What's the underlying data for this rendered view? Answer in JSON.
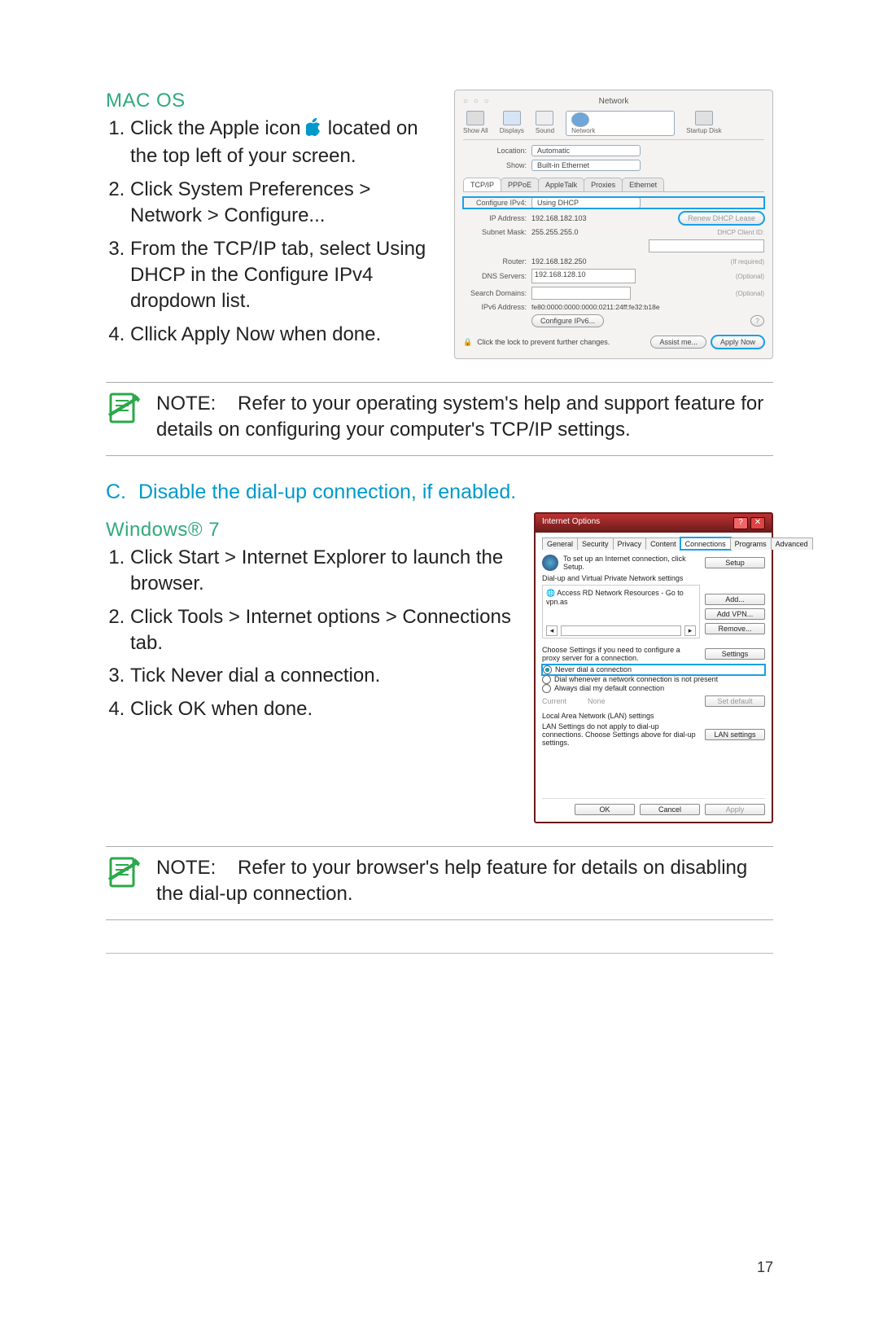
{
  "page_number": "17",
  "section_mac": {
    "title": "MAC OS",
    "steps": [
      "Click the Apple icon      located on the top left of your screen.",
      "Click System Preferences > Network > Configure...",
      "From the TCP/IP tab, select Using DHCP in the Configure IPv4 dropdown list.",
      "Cllick Apply Now when done."
    ]
  },
  "section_c": {
    "prefix": "C.",
    "title": "Disable the dial-up connection, if enabled."
  },
  "section_win": {
    "title": "Windows® 7",
    "steps": [
      "Click Start > Internet Explorer to launch the browser.",
      "Click Tools > Internet options > Connections tab.",
      "Tick Never dial a connection.",
      "Click OK when done."
    ]
  },
  "note1": {
    "label": "NOTE:",
    "text": "Refer to your operating system's help and support feature for details on configuring your computer's TCP/IP settings."
  },
  "note2": {
    "label": "NOTE:",
    "text": "Refer to your browser's help feature for details on disabling the dial-up connection."
  },
  "mac_shot": {
    "window_title": "Network",
    "toolbar": [
      "Show All",
      "Displays",
      "Sound",
      "Network",
      "Startup Disk"
    ],
    "location_label": "Location:",
    "location_value": "Automatic",
    "show_label": "Show:",
    "show_value": "Built-in Ethernet",
    "tabs": [
      "TCP/IP",
      "PPPoE",
      "AppleTalk",
      "Proxies",
      "Ethernet"
    ],
    "cfg_label": "Configure IPv4:",
    "cfg_value": "Using DHCP",
    "ip_label": "IP Address:",
    "ip_value": "192.168.182.103",
    "renew": "Renew DHCP Lease",
    "mask_label": "Subnet Mask:",
    "mask_value": "255.255.255.0",
    "client_label": "DHCP Client ID:",
    "client_hint": "(If required)",
    "router_label": "Router:",
    "router_value": "192.168.182.250",
    "dns_label": "DNS Servers:",
    "dns_value": "192.168.128.10",
    "optional": "(Optional)",
    "search_label": "Search Domains:",
    "ipv6_label": "IPv6 Address:",
    "ipv6_value": "fe80:0000:0000:0000:0211:24ff:fe32:b18e",
    "cfg6_btn": "Configure IPv6...",
    "help": "?",
    "lock_text": "Click the lock to prevent further changes.",
    "assist": "Assist me...",
    "apply": "Apply Now"
  },
  "win_shot": {
    "title": "Internet Options",
    "tabs": [
      "General",
      "Security",
      "Privacy",
      "Content",
      "Connections",
      "Programs",
      "Advanced"
    ],
    "setup_text": "To set up an Internet connection, click Setup.",
    "setup_btn": "Setup",
    "dial_group": "Dial-up and Virtual Private Network settings",
    "dial_item": "Access RD Network Resources - Go to vpn.as",
    "add": "Add...",
    "add_vpn": "Add VPN...",
    "remove": "Remove...",
    "choose_text": "Choose Settings if you need to configure a proxy server for a connection.",
    "settings": "Settings",
    "r_never": "Never dial a connection",
    "r_when": "Dial whenever a network connection is not present",
    "r_always": "Always dial my default connection",
    "current": "Current",
    "none": "None",
    "setdef": "Set default",
    "lan_group": "Local Area Network (LAN) settings",
    "lan_text": "LAN Settings do not apply to dial-up connections. Choose Settings above for dial-up settings.",
    "lan_btn": "LAN settings",
    "ok": "OK",
    "cancel": "Cancel",
    "apply": "Apply"
  }
}
